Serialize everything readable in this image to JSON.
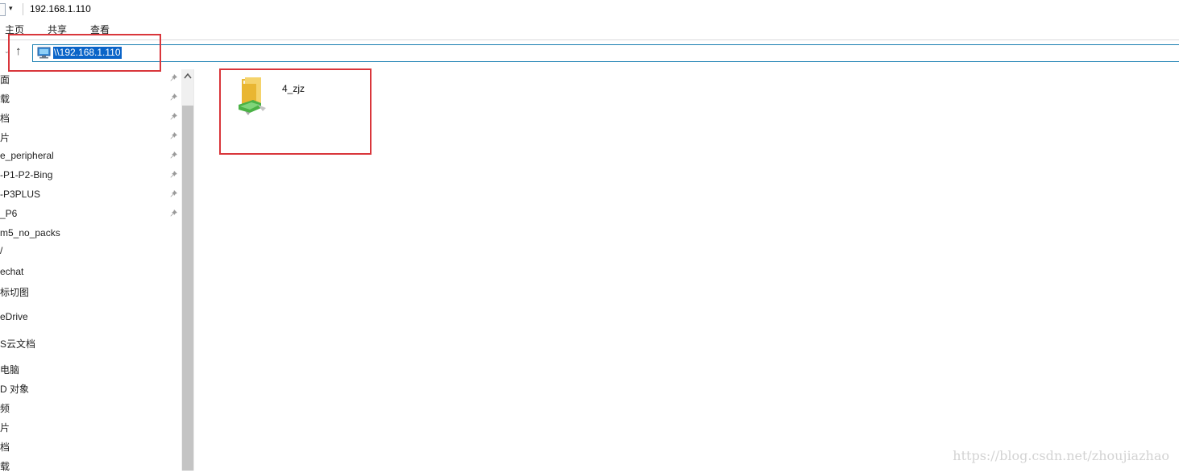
{
  "window": {
    "title": "192.168.1.110"
  },
  "quick_access_toolbar": {
    "dropdown_symbol": "▾"
  },
  "ribbon": {
    "tabs": [
      "主页",
      "共享",
      "查看"
    ]
  },
  "address_bar": {
    "path": "\\\\192.168.1.110",
    "up_symbol": "↑",
    "chevron_symbol": "⌄"
  },
  "sidebar": {
    "items": [
      {
        "label": "面",
        "pinned": true
      },
      {
        "label": "载",
        "pinned": true
      },
      {
        "label": "档",
        "pinned": true
      },
      {
        "label": "片",
        "pinned": true
      },
      {
        "label": "e_peripheral",
        "pinned": true
      },
      {
        "label": "-P1-P2-Bing",
        "pinned": true
      },
      {
        "label": "-P3PLUS",
        "pinned": true
      },
      {
        "label": "_P6",
        "pinned": true
      },
      {
        "label": "m5_no_packs",
        "pinned": false
      },
      {
        "label": "/",
        "pinned": false
      },
      {
        "label": "echat",
        "pinned": false
      },
      {
        "label": "标切图",
        "pinned": false
      },
      {
        "label": "eDrive",
        "pinned": false
      },
      {
        "label": "S云文档",
        "pinned": false
      },
      {
        "label": "电脑",
        "pinned": false
      },
      {
        "label": "D 对象",
        "pinned": false
      },
      {
        "label": "频",
        "pinned": false
      },
      {
        "label": "片",
        "pinned": false
      },
      {
        "label": "档",
        "pinned": false
      },
      {
        "label": "载",
        "pinned": false
      }
    ]
  },
  "content": {
    "items": [
      {
        "name": "4_zjz",
        "icon": "shared-folder-icon"
      }
    ]
  },
  "watermark": {
    "text": "https://blog.csdn.net/zhoujiazhao"
  },
  "colors": {
    "selection": "#0a64c8",
    "annotation_red": "#d9363b",
    "addr_border": "#1a7fb2"
  }
}
